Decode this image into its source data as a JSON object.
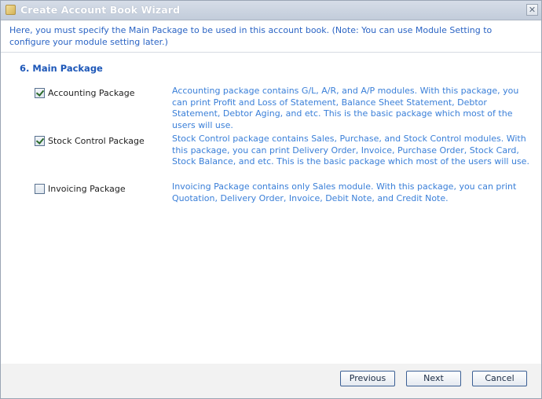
{
  "window": {
    "title": "Create Account Book Wizard",
    "close_symbol": "✕"
  },
  "header": {
    "text": "Here, you must specify the Main Package to be used in this account book. (Note: You can use Module Setting to configure your module setting later.)"
  },
  "section": {
    "title": "6. Main Package"
  },
  "packages": [
    {
      "label": "Accounting Package",
      "checked": true,
      "description": "Accounting package contains G/L, A/R, and A/P modules. With this package, you can print Profit and Loss of Statement, Balance Sheet Statement, Debtor Statement, Debtor Aging, and etc. This is the basic package which most of the users will use."
    },
    {
      "label": "Stock Control Package",
      "checked": true,
      "description": "Stock Control package contains Sales, Purchase, and Stock Control modules. With this package, you can print Delivery Order, Invoice, Purchase Order, Stock Card, Stock Balance, and etc. This is the basic package which most of the users will use."
    },
    {
      "label": "Invoicing Package",
      "checked": false,
      "description": "Invoicing Package contains only Sales module. With this package, you can print Quotation, Delivery Order, Invoice, Debit Note, and Credit Note."
    }
  ],
  "buttons": {
    "previous": "Previous",
    "next": "Next",
    "cancel": "Cancel"
  },
  "colors": {
    "header_text": "#2b64c4",
    "section_title": "#1d57b8",
    "description_text": "#3a7fd8"
  }
}
